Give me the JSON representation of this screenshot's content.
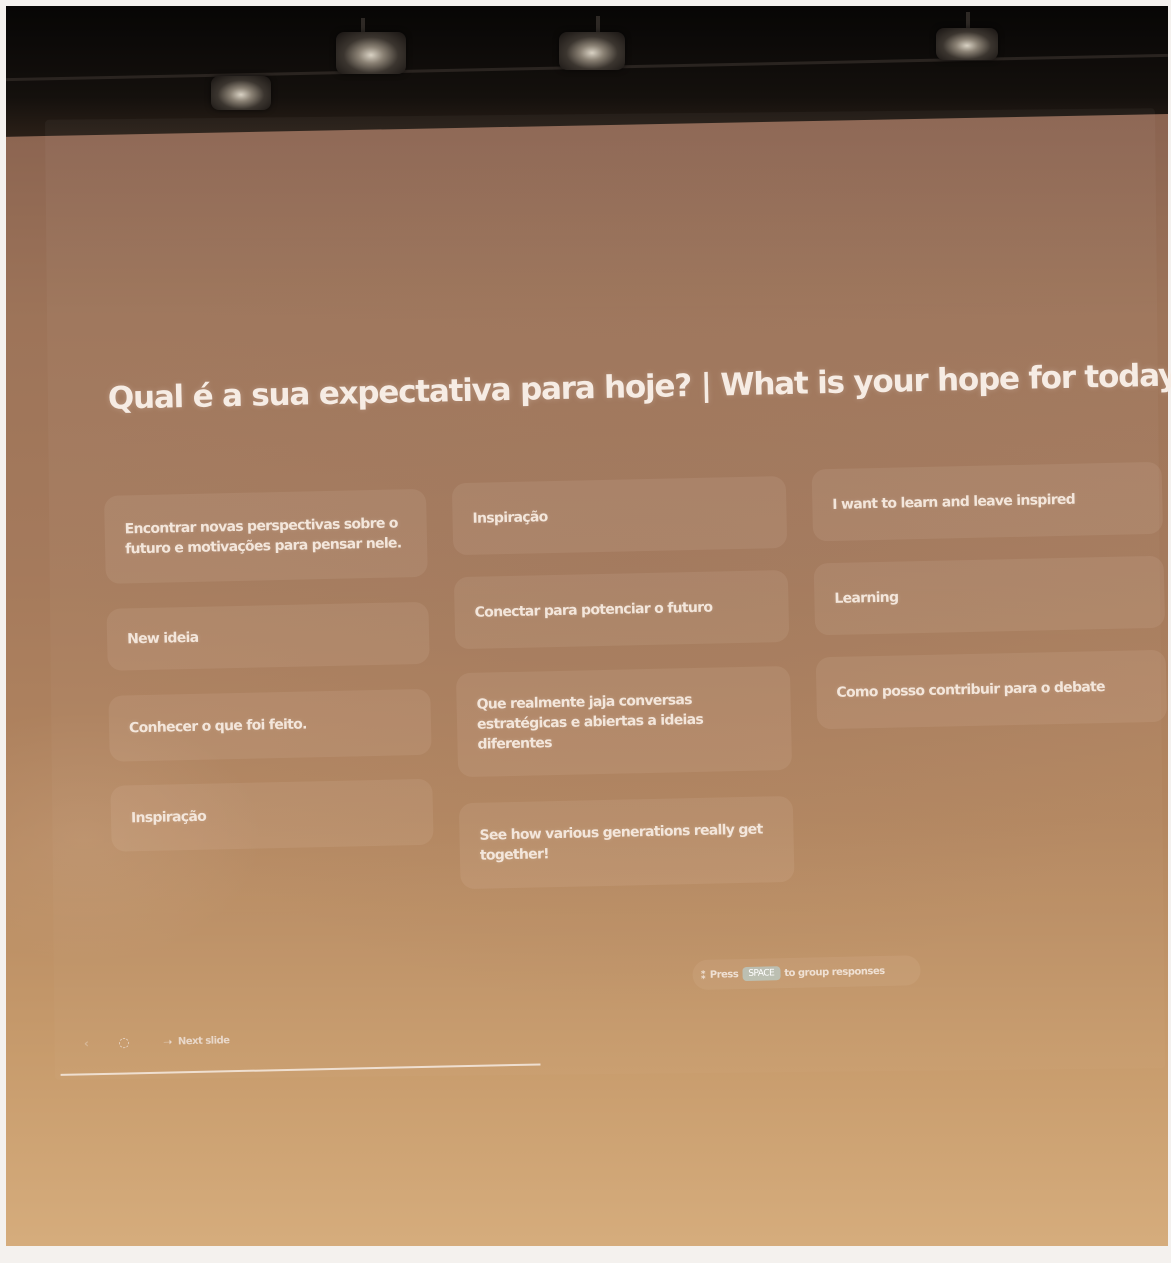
{
  "slide": {
    "title": "Qual é a sua expectativa para hoje? | What is your hope for today?",
    "responses": {
      "column1": [
        "Encontrar novas perspectivas sobre o futuro e motivações para pensar nele.",
        "New ideia",
        "Conhecer o que foi feito.",
        "Inspiração"
      ],
      "column2": [
        "Inspiração",
        "Conectar para potenciar o futuro",
        "Que realmente jaja conversas estratégicas e abiertas a ideias diferentes",
        "See how various generations really get together!"
      ],
      "column3": [
        "I want to learn and leave inspired",
        "Learning",
        "Como posso contribuir para o debate"
      ]
    },
    "hint": {
      "icon": "group-icon",
      "before": "Press",
      "key": "SPACE",
      "after": "to group responses"
    },
    "nav": {
      "prev_icon": "chevron-left-icon",
      "pin_icon": "pin-icon",
      "next_icon": "arrow-right-icon",
      "next_label": "Next slide"
    }
  }
}
